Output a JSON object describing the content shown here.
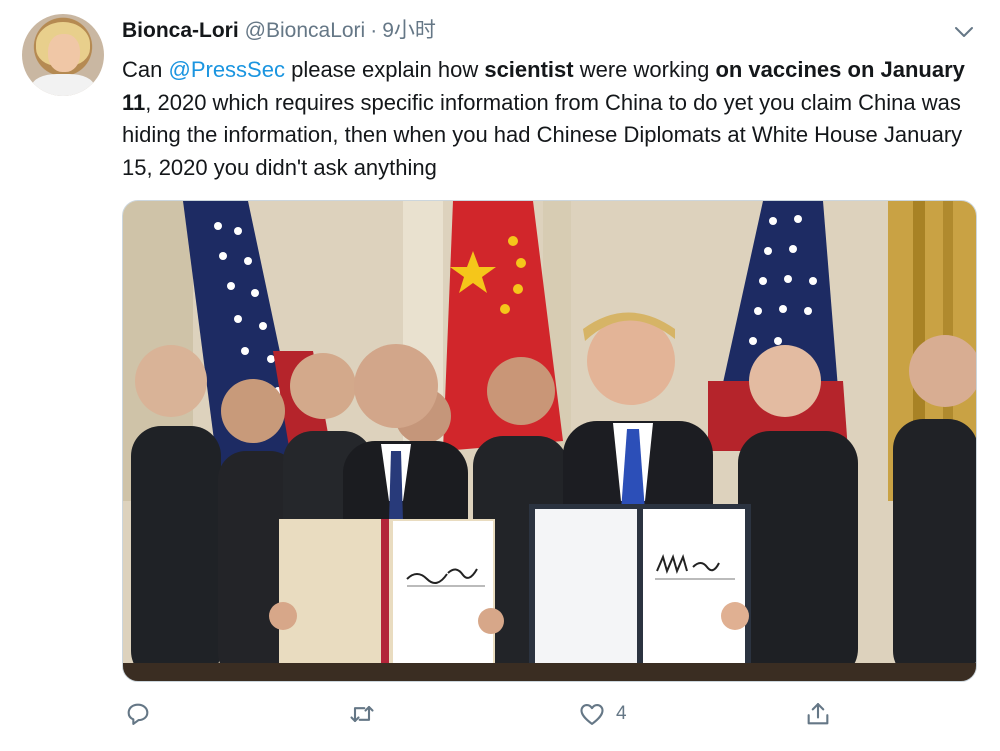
{
  "tweet": {
    "author_name": "Bionca-Lori",
    "author_handle": "@BioncaLori",
    "separator": "·",
    "time": "9小时",
    "text": {
      "p1": "Can ",
      "mention": "@PressSec",
      "p2": " please explain how ",
      "bold1": "scientist",
      "p3": " were working ",
      "bold2": "on vaccines on January 11",
      "p4": ", 2020 which requires specific information from China to do yet you claim China was hiding the information, then when you had Chinese Diplomats at White House January 15, 2020 you didn't ask anything"
    },
    "actions": {
      "reply_count": "",
      "retweet_count": "",
      "like_count": "4",
      "share_count": ""
    },
    "icons": {
      "menu": "chevron-down-icon",
      "reply": "reply-icon",
      "retweet": "retweet-icon",
      "like": "heart-icon",
      "share": "share-icon"
    },
    "colors": {
      "text": "#14171a",
      "secondary": "#657786",
      "link": "#1b95e0"
    }
  }
}
